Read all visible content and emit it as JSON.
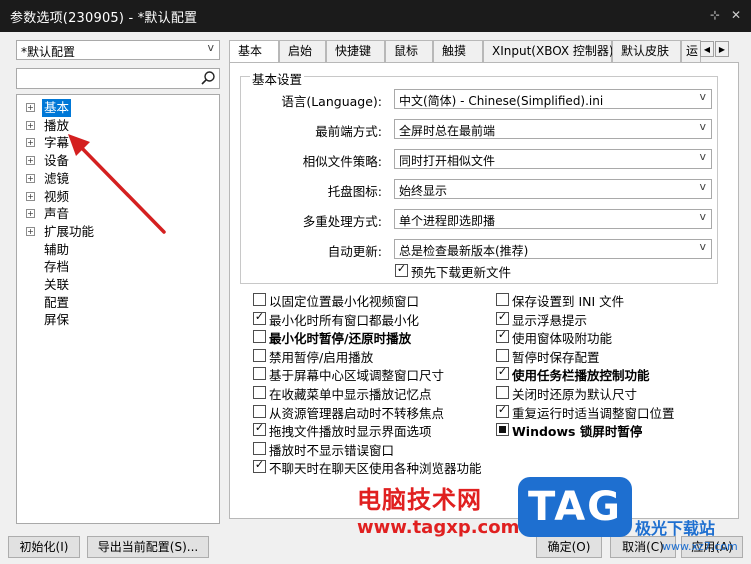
{
  "window": {
    "title": "参数选项(230905) - *默认配置",
    "pin_glyph": "⊹",
    "close_glyph": "✕"
  },
  "left": {
    "profile_value": "*默认配置",
    "search_placeholder": "",
    "tree": [
      {
        "label": "基本",
        "expandable": true,
        "selected": true
      },
      {
        "label": "播放",
        "expandable": true
      },
      {
        "label": "字幕",
        "expandable": true
      },
      {
        "label": "设备",
        "expandable": true
      },
      {
        "label": "滤镜",
        "expandable": true
      },
      {
        "label": "视频",
        "expandable": true
      },
      {
        "label": "声音",
        "expandable": true
      },
      {
        "label": "扩展功能",
        "expandable": true
      },
      {
        "label": "辅助",
        "expandable": false
      },
      {
        "label": "存档",
        "expandable": false
      },
      {
        "label": "关联",
        "expandable": false
      },
      {
        "label": "配置",
        "expandable": false
      },
      {
        "label": "屏保",
        "expandable": false
      }
    ]
  },
  "tabs": [
    "基本",
    "启始",
    "快捷键",
    "鼠标",
    "触摸",
    "XInput(XBOX 控制器)",
    "默认皮肤",
    "运"
  ],
  "basic": {
    "group_title": "基本设置",
    "settings": [
      {
        "label": "语言(Language):",
        "value": "中文(简体) - Chinese(Simplified).ini"
      },
      {
        "label": "最前端方式:",
        "value": "全屏时总在最前端"
      },
      {
        "label": "相似文件策略:",
        "value": "同时打开相似文件"
      },
      {
        "label": "托盘图标:",
        "value": "始终显示"
      },
      {
        "label": "多重处理方式:",
        "value": "单个进程即选即播"
      },
      {
        "label": "自动更新:",
        "value": "总是检查最新版本(推荐)"
      }
    ],
    "predownload_label": "预先下载更新文件",
    "left_options": [
      {
        "label": "以固定位置最小化视频窗口",
        "state": "unchecked"
      },
      {
        "label": "最小化时所有窗口都最小化",
        "state": "checked"
      },
      {
        "label": "最小化时暂停/还原时播放",
        "state": "unchecked",
        "bold": true
      },
      {
        "label": "禁用暂停/启用播放",
        "state": "unchecked"
      },
      {
        "label": "基于屏幕中心区域调整窗口尺寸",
        "state": "unchecked"
      },
      {
        "label": "在收藏菜单中显示播放记忆点",
        "state": "unchecked"
      },
      {
        "label": "从资源管理器启动时不转移焦点",
        "state": "unchecked"
      },
      {
        "label": "拖拽文件播放时显示界面选项",
        "state": "checked"
      },
      {
        "label": "播放时不显示错误窗口",
        "state": "unchecked"
      },
      {
        "label": "不聊天时在聊天区使用各种浏览器功能",
        "state": "checked"
      }
    ],
    "right_options": [
      {
        "label": "保存设置到 INI 文件",
        "state": "unchecked"
      },
      {
        "label": "显示浮悬提示",
        "state": "checked"
      },
      {
        "label": "使用窗体吸附功能",
        "state": "checked"
      },
      {
        "label": "暂停时保存配置",
        "state": "unchecked"
      },
      {
        "label": "使用任务栏播放控制功能",
        "state": "checked",
        "bold": true
      },
      {
        "label": "关闭时还原为默认尺寸",
        "state": "unchecked"
      },
      {
        "label": "重复运行时适当调整窗口位置",
        "state": "checked"
      },
      {
        "label": "Windows 锁屏时暂停",
        "state": "partial",
        "bold": true
      }
    ]
  },
  "bottom": {
    "init_button": "初始化(I)",
    "export_button": "导出当前配置(S)...",
    "ok_button": "确定(O)",
    "cancel_button": "取消(C)",
    "apply_button": "应用(A)"
  },
  "watermark": {
    "text": "电脑技术网",
    "url": "www.tagxp.com",
    "logo": "TAG",
    "site": "极光下载站",
    "site_url": "www.xz7.com"
  },
  "colors": {
    "selection": "#0078d7",
    "arrow": "#d42020",
    "title_bar": "#1b1b1b"
  }
}
